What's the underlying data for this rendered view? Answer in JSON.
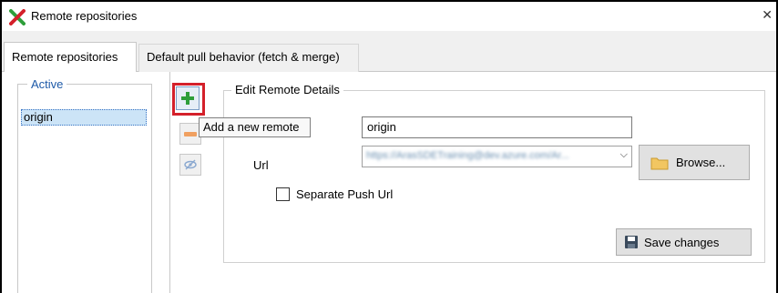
{
  "window": {
    "title": "Remote repositories",
    "close_glyph": "✕"
  },
  "tabs": [
    {
      "label": "Remote repositories",
      "active": true
    },
    {
      "label": "Default pull behavior (fetch & merge)",
      "active": false
    }
  ],
  "remotes_panel": {
    "legend": "Active",
    "items": [
      "origin"
    ]
  },
  "toolbar": {
    "add_icon": "plus-icon",
    "remove_icon": "minus-icon",
    "visibility_icon": "eye-hidden-icon",
    "tooltip": "Add a new remote"
  },
  "details": {
    "legend": "Edit Remote Details",
    "name_value": "origin",
    "url_label": "Url",
    "url_value": "https://ArasSDETraining@dev.azure.com/Ar...",
    "browse_label": "Browse...",
    "separate_push_label": "Separate Push Url",
    "separate_push_checked": false,
    "save_label": "Save changes"
  },
  "colors": {
    "accent": "#3a75c4",
    "selection": "#cce4f7",
    "highlight": "#d4202a",
    "add_green": "#2e9e3a"
  }
}
